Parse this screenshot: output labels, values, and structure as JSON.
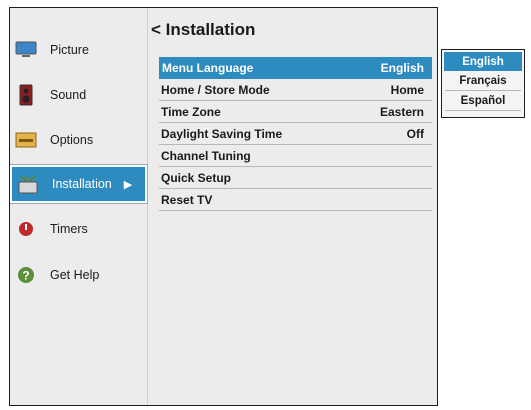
{
  "sidebar": {
    "items": [
      {
        "label": "Picture",
        "icon": "monitor-icon"
      },
      {
        "label": "Sound",
        "icon": "speaker-icon"
      },
      {
        "label": "Options",
        "icon": "options-icon"
      },
      {
        "label": "Installation",
        "icon": "installation-icon",
        "active": true
      },
      {
        "label": "Timers",
        "icon": "timer-icon"
      },
      {
        "label": "Get Help",
        "icon": "help-icon"
      }
    ],
    "active_arrow": "▶"
  },
  "main": {
    "title": "< Installation",
    "rows": [
      {
        "label": "Menu Language",
        "value": "English"
      },
      {
        "label": "Home / Store Mode",
        "value": "Home"
      },
      {
        "label": "Time Zone",
        "value": "Eastern"
      },
      {
        "label": "Daylight Saving Time",
        "value": "Off"
      },
      {
        "label": "Channel Tuning",
        "value": ""
      },
      {
        "label": "Quick Setup",
        "value": ""
      },
      {
        "label": "Reset TV",
        "value": ""
      }
    ]
  },
  "language_popup": {
    "options": [
      "English",
      "Français",
      "Español"
    ],
    "selected": "English"
  },
  "colors": {
    "accent": "#2e8bbf",
    "panel": "#ececec",
    "text": "#1a1a1a"
  }
}
